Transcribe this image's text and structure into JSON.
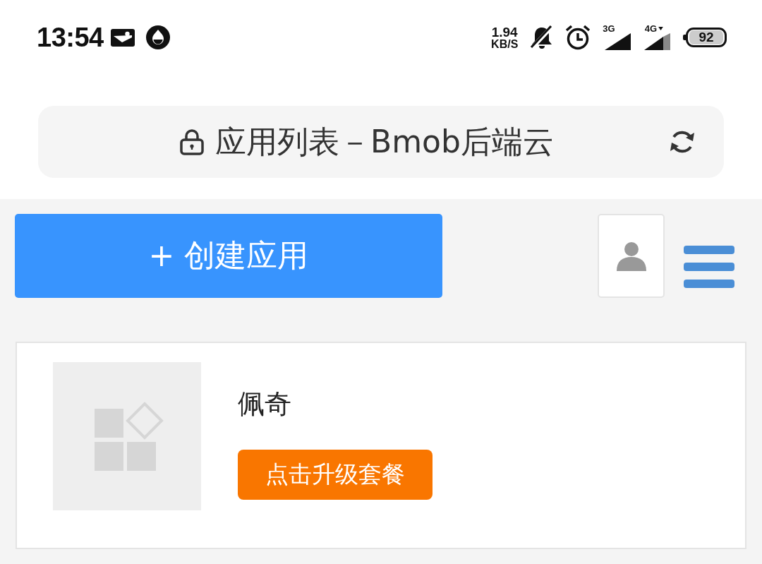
{
  "status_bar": {
    "time": "13:54",
    "net_speed": {
      "value": "1.94",
      "unit": "KB/S"
    },
    "signals": [
      {
        "label": "3G",
        "data_active": false
      },
      {
        "label": "4G",
        "data_active": true
      }
    ],
    "battery": "92"
  },
  "address_bar": {
    "title": "应用列表－Bmob后端云",
    "secure": true
  },
  "toolbar": {
    "create_button": "+ 创建应用"
  },
  "apps": [
    {
      "name": "佩奇",
      "upgrade_button": "点击升级套餐"
    }
  ]
}
